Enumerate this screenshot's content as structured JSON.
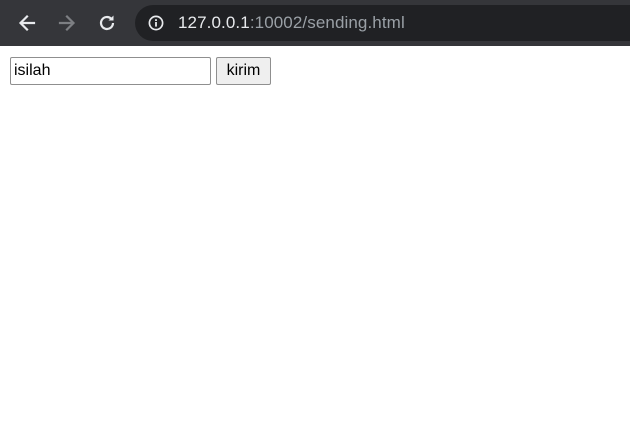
{
  "browser": {
    "url_host": "127.0.0.1",
    "url_rest": ":10002/sending.html",
    "icons": {
      "back": "arrow-left-icon",
      "forward": "arrow-right-icon",
      "reload": "reload-icon",
      "site_info": "info-circle-icon"
    },
    "colors": {
      "toolbar_bg": "#35363a",
      "omnibox_bg": "#202124",
      "url_host": "#e8eaed",
      "url_rest": "#9aa0a6"
    }
  },
  "form": {
    "input_value": "isilah",
    "button_label": "kirim"
  }
}
